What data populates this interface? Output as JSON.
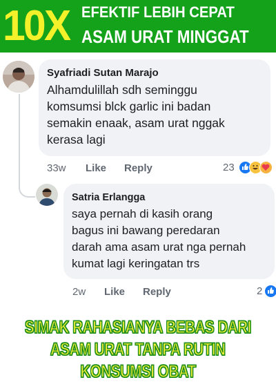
{
  "banner": {
    "big": "10X",
    "line1": "EFEKTIF LEBIH CEPAT",
    "line2": "ASAM URAT MINGGAT"
  },
  "comments": [
    {
      "author": "Syafriadi Sutan Marajo",
      "lines": [
        "Alhamdulillah sdh seminggu",
        "komsumsi blck garlic ini badan",
        "semakin enaak, asam urat nggak",
        "kerasa lagi"
      ],
      "time": "33w",
      "like": "Like",
      "reply": "Reply",
      "reaction_count": "23",
      "reactions": [
        "like-icon",
        "haha-icon",
        "love-icon"
      ]
    },
    {
      "author": "Satria Erlangga",
      "lines": [
        "saya pernah di kasih orang",
        "bagus ini bawang peredaran",
        "darah ama asam urat nga pernah",
        "kumat lagi keringatan trs"
      ],
      "time": "2w",
      "like": "Like",
      "reply": "Reply",
      "reaction_count": "2",
      "reactions": [
        "like-icon"
      ]
    }
  ],
  "promo": {
    "line1": "SIMAK RAHASIANYA BEBAS DARI",
    "line2": "ASAM URAT TANPA RUTIN",
    "line3": "KONSUMSI OBAT"
  },
  "colors": {
    "banner_green": "#14a21b",
    "banner_yellow": "#f4f12a",
    "bubble_gray": "#f0f2f5",
    "like_blue": "#1877f2",
    "promo_yellow": "#f4ee3a",
    "promo_outline": "#1f8f19"
  }
}
